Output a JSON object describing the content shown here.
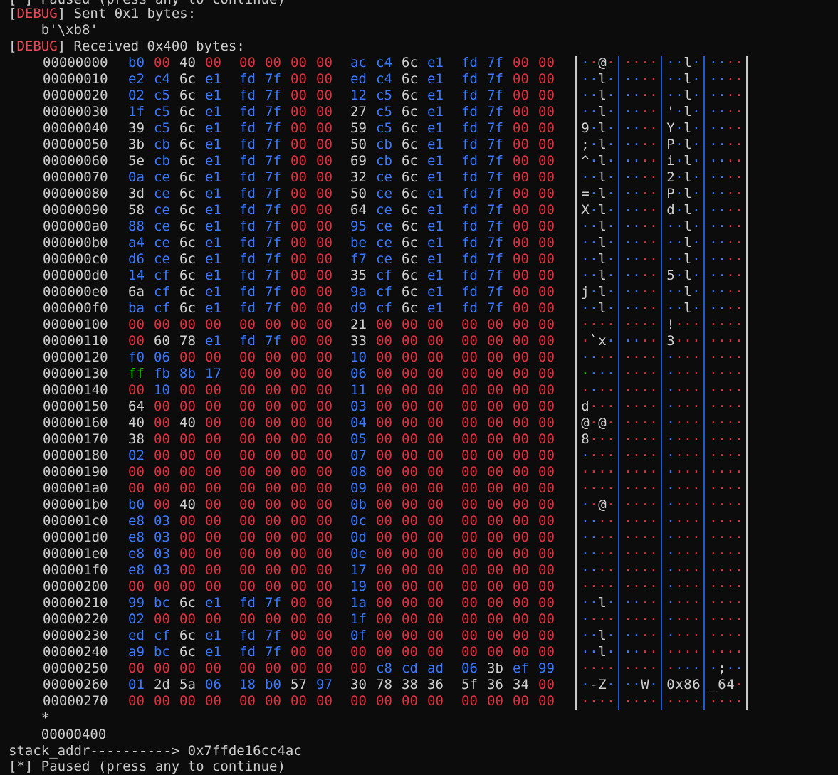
{
  "terminal": {
    "top_partial": "[*] Paused (press any to continue)",
    "debug_tag": "DEBUG",
    "sent_line": " Sent 0x1 bytes:",
    "sent_payload": "    b'\\xb8'",
    "recv_line": " Received 0x400 bytes:",
    "repeat_marker": "    *",
    "end_offset": "    00000400",
    "stack_line": "stack_addr----------> 0x7ffde16cc4ac",
    "bottom_partial": "[*] Paused (press any to continue)"
  },
  "colors": {
    "null_byte": "#e0303f",
    "printable": "#d0d0d0",
    "high_or_nonprint": "#3b78ff",
    "ff_byte": "#16c60c"
  },
  "hexdump": [
    {
      "offset": "00000000",
      "bytes": "b0 00 40 00 00 00 00 00 ac c4 6c e1 fd 7f 00 00"
    },
    {
      "offset": "00000010",
      "bytes": "e2 c4 6c e1 fd 7f 00 00 ed c4 6c e1 fd 7f 00 00"
    },
    {
      "offset": "00000020",
      "bytes": "02 c5 6c e1 fd 7f 00 00 12 c5 6c e1 fd 7f 00 00"
    },
    {
      "offset": "00000030",
      "bytes": "1f c5 6c e1 fd 7f 00 00 27 c5 6c e1 fd 7f 00 00"
    },
    {
      "offset": "00000040",
      "bytes": "39 c5 6c e1 fd 7f 00 00 59 c5 6c e1 fd 7f 00 00"
    },
    {
      "offset": "00000050",
      "bytes": "3b cb 6c e1 fd 7f 00 00 50 cb 6c e1 fd 7f 00 00"
    },
    {
      "offset": "00000060",
      "bytes": "5e cb 6c e1 fd 7f 00 00 69 cb 6c e1 fd 7f 00 00"
    },
    {
      "offset": "00000070",
      "bytes": "0a ce 6c e1 fd 7f 00 00 32 ce 6c e1 fd 7f 00 00"
    },
    {
      "offset": "00000080",
      "bytes": "3d ce 6c e1 fd 7f 00 00 50 ce 6c e1 fd 7f 00 00"
    },
    {
      "offset": "00000090",
      "bytes": "58 ce 6c e1 fd 7f 00 00 64 ce 6c e1 fd 7f 00 00"
    },
    {
      "offset": "000000a0",
      "bytes": "88 ce 6c e1 fd 7f 00 00 95 ce 6c e1 fd 7f 00 00"
    },
    {
      "offset": "000000b0",
      "bytes": "a4 ce 6c e1 fd 7f 00 00 be ce 6c e1 fd 7f 00 00"
    },
    {
      "offset": "000000c0",
      "bytes": "d6 ce 6c e1 fd 7f 00 00 f7 ce 6c e1 fd 7f 00 00"
    },
    {
      "offset": "000000d0",
      "bytes": "14 cf 6c e1 fd 7f 00 00 35 cf 6c e1 fd 7f 00 00"
    },
    {
      "offset": "000000e0",
      "bytes": "6a cf 6c e1 fd 7f 00 00 9a cf 6c e1 fd 7f 00 00"
    },
    {
      "offset": "000000f0",
      "bytes": "ba cf 6c e1 fd 7f 00 00 d9 cf 6c e1 fd 7f 00 00"
    },
    {
      "offset": "00000100",
      "bytes": "00 00 00 00 00 00 00 00 21 00 00 00 00 00 00 00"
    },
    {
      "offset": "00000110",
      "bytes": "00 60 78 e1 fd 7f 00 00 33 00 00 00 00 00 00 00"
    },
    {
      "offset": "00000120",
      "bytes": "f0 06 00 00 00 00 00 00 10 00 00 00 00 00 00 00"
    },
    {
      "offset": "00000130",
      "bytes": "ff fb 8b 17 00 00 00 00 06 00 00 00 00 00 00 00"
    },
    {
      "offset": "00000140",
      "bytes": "00 10 00 00 00 00 00 00 11 00 00 00 00 00 00 00"
    },
    {
      "offset": "00000150",
      "bytes": "64 00 00 00 00 00 00 00 03 00 00 00 00 00 00 00"
    },
    {
      "offset": "00000160",
      "bytes": "40 00 40 00 00 00 00 00 04 00 00 00 00 00 00 00"
    },
    {
      "offset": "00000170",
      "bytes": "38 00 00 00 00 00 00 00 05 00 00 00 00 00 00 00"
    },
    {
      "offset": "00000180",
      "bytes": "02 00 00 00 00 00 00 00 07 00 00 00 00 00 00 00"
    },
    {
      "offset": "00000190",
      "bytes": "00 00 00 00 00 00 00 00 08 00 00 00 00 00 00 00"
    },
    {
      "offset": "000001a0",
      "bytes": "00 00 00 00 00 00 00 00 09 00 00 00 00 00 00 00"
    },
    {
      "offset": "000001b0",
      "bytes": "b0 00 40 00 00 00 00 00 0b 00 00 00 00 00 00 00"
    },
    {
      "offset": "000001c0",
      "bytes": "e8 03 00 00 00 00 00 00 0c 00 00 00 00 00 00 00"
    },
    {
      "offset": "000001d0",
      "bytes": "e8 03 00 00 00 00 00 00 0d 00 00 00 00 00 00 00"
    },
    {
      "offset": "000001e0",
      "bytes": "e8 03 00 00 00 00 00 00 0e 00 00 00 00 00 00 00"
    },
    {
      "offset": "000001f0",
      "bytes": "e8 03 00 00 00 00 00 00 17 00 00 00 00 00 00 00"
    },
    {
      "offset": "00000200",
      "bytes": "00 00 00 00 00 00 00 00 19 00 00 00 00 00 00 00"
    },
    {
      "offset": "00000210",
      "bytes": "99 bc 6c e1 fd 7f 00 00 1a 00 00 00 00 00 00 00"
    },
    {
      "offset": "00000220",
      "bytes": "02 00 00 00 00 00 00 00 1f 00 00 00 00 00 00 00"
    },
    {
      "offset": "00000230",
      "bytes": "ed cf 6c e1 fd 7f 00 00 0f 00 00 00 00 00 00 00"
    },
    {
      "offset": "00000240",
      "bytes": "a9 bc 6c e1 fd 7f 00 00 00 00 00 00 00 00 00 00"
    },
    {
      "offset": "00000250",
      "bytes": "00 00 00 00 00 00 00 00 00 c8 cd ad 06 3b ef 99"
    },
    {
      "offset": "00000260",
      "bytes": "01 2d 5a 06 18 b0 57 97 30 78 38 36 5f 36 34 00"
    },
    {
      "offset": "00000270",
      "bytes": "00 00 00 00 00 00 00 00 00 00 00 00 00 00 00 00"
    }
  ]
}
